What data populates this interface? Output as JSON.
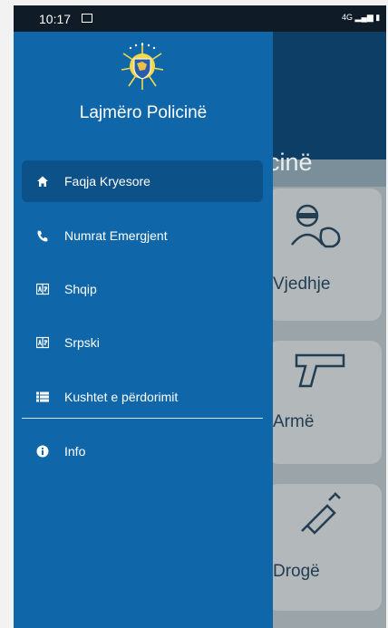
{
  "status_bar": {
    "time": "10:17",
    "network": "4G"
  },
  "background": {
    "title": "cinë",
    "cards": [
      {
        "label": "Vjedhje",
        "icon": "thief-icon"
      },
      {
        "label": "Armë",
        "icon": "gun-icon"
      },
      {
        "label": "Drogë",
        "icon": "syringe-icon"
      }
    ]
  },
  "drawer": {
    "app_title": "Lajmëro Policinë",
    "items": [
      {
        "label": "Faqja Kryesore",
        "icon": "home-icon",
        "active": true
      },
      {
        "label": "Numrat Emergjent",
        "icon": "phone-icon"
      },
      {
        "label": "Shqip",
        "icon": "language-icon"
      },
      {
        "label": "Srpski",
        "icon": "language-icon"
      },
      {
        "label": "Kushtet e përdorimit",
        "icon": "list-icon"
      },
      {
        "label": "Info",
        "icon": "info-icon"
      }
    ]
  },
  "colors": {
    "drawer": "#0f67a9",
    "active_item": "#0c5288",
    "header": "#0d3f66"
  }
}
